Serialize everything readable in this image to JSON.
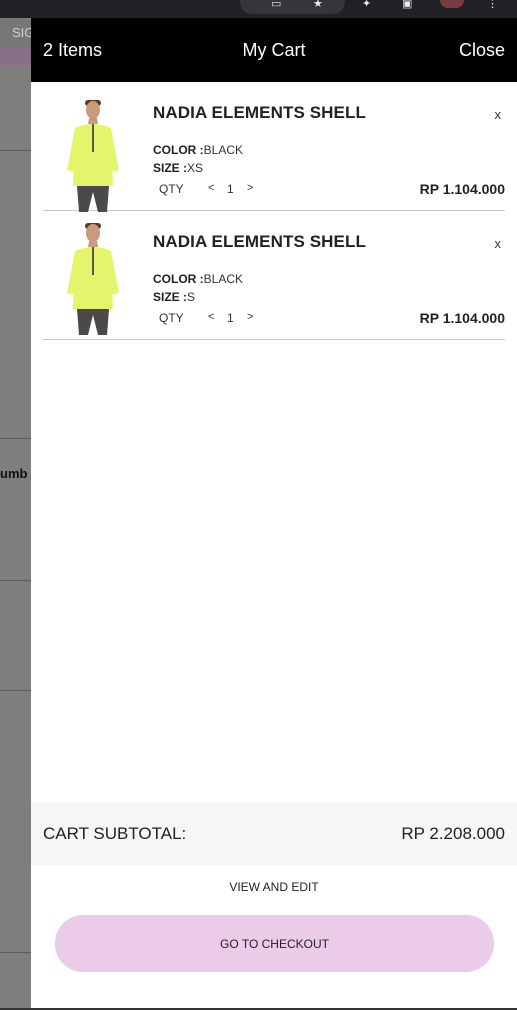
{
  "background_page": {
    "tab_label": "SIG",
    "partial_text": "umb"
  },
  "cart": {
    "item_count_label": "2 Items",
    "title": "My Cart",
    "close_label": "Close",
    "items": [
      {
        "name": "NADIA ELEMENTS SHELL",
        "remove_label": "x",
        "color_label": "COLOR :",
        "color_value": "BLACK",
        "size_label": "SIZE :",
        "size_value": "XS",
        "qty_label": "QTY",
        "qty_decrease": "<",
        "qty_value": "1",
        "qty_increase": ">",
        "price": "RP 1.104.000"
      },
      {
        "name": "NADIA ELEMENTS SHELL",
        "remove_label": "x",
        "color_label": "COLOR :",
        "color_value": "BLACK",
        "size_label": "SIZE :",
        "size_value": "S",
        "qty_label": "QTY",
        "qty_decrease": "<",
        "qty_value": "1",
        "qty_increase": ">",
        "price": "RP 1.104.000"
      }
    ],
    "subtotal_label": "CART SUBTOTAL:",
    "subtotal_value": "RP 2.208.000",
    "view_edit_label": "VIEW AND EDIT",
    "checkout_label": "GO TO CHECKOUT"
  },
  "icons": {
    "product_image": "product-thumbnail-icon",
    "browser": [
      "share-icon",
      "star-icon",
      "extension-icon",
      "sidebar-icon",
      "profile-avatar-icon",
      "menu-icon"
    ]
  },
  "colors": {
    "header_bg": "#000000",
    "checkout_bg": "#ebcbe8",
    "subtotal_bg": "#f6f6f6",
    "overlay": "#7e7e7e"
  }
}
